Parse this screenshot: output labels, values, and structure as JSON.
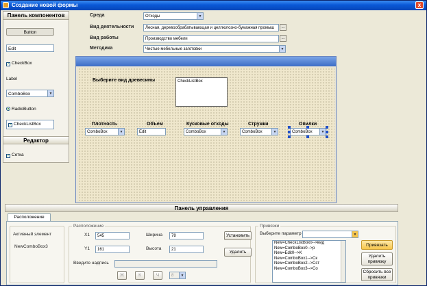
{
  "window": {
    "title": "Создание новой формы",
    "close_glyph": "x"
  },
  "palette": {
    "title": "Панель компонентов",
    "button": "Button",
    "edit": "Edit",
    "checkbox": "CheckBox",
    "label": "Label",
    "combobox": "ComboBox",
    "radiobutton": "RadioButton",
    "checklistbox": "CheckListBox",
    "editor_title": "Редактор",
    "grid": "Сетка"
  },
  "params": {
    "env_label": "Среда",
    "env_value": "Отходы",
    "activity_label": "Вид деятельности",
    "activity_value": "Лесная, деревообрабатывающая и целлюлозно-бумажная промыш",
    "work_label": "Вид работы",
    "work_value": "Производство мебели",
    "method_label": "Методика",
    "method_value": "Чистые мебельные заготовки",
    "ellipsis": "..."
  },
  "form": {
    "wood_label": "Выберите вид древесины",
    "checklist": "CheckListBox",
    "columns": [
      {
        "label": "Плотность",
        "control": "ComboBox"
      },
      {
        "label": "Объем",
        "control": "Edit"
      },
      {
        "label": "Кусковые отходы",
        "control": "ComboBox"
      },
      {
        "label": "Стружки",
        "control": "ComboBox"
      },
      {
        "label": "Опилки",
        "control": "ComboBox"
      }
    ]
  },
  "control_panel": {
    "title": "Панель управления",
    "tab": "Расположение",
    "active_element_label": "Активный элемент",
    "active_element_value": "NewComboBox3",
    "layout": {
      "title": "Расположение",
      "x1_label": "X1",
      "x1_value": "545",
      "y1_label": "Y1",
      "y1_value": "161",
      "width_label": "Ширина",
      "width_value": "78",
      "height_label": "Высота",
      "height_value": "21",
      "set_button": "Установить",
      "delete_button": "Удалить",
      "caption_label": "Введите надпись",
      "caption_value": "",
      "bold": "Ж",
      "italic": "К",
      "underline": "Ч",
      "font_size": "8"
    },
    "bindings": {
      "title": "Привязки",
      "param_label": "Выберите параметр",
      "param_value": "",
      "items": [
        "New=CheckListBox0-->вид",
        "New=ComboBox0-->р",
        "New=Edit0-->K",
        "New=ComboBox1-->Ск",
        "New=ComboBox2-->Сст",
        "New=ComboBox3-->Со"
      ],
      "bind_button": "Привязать",
      "unbind_button": "Удалить привязку",
      "reset_button": "Сбросить все привязки"
    }
  },
  "colors": {
    "title_bar": "#0a58d6",
    "accent_button": "#f7c64a",
    "canvas": "#efe7cc"
  }
}
